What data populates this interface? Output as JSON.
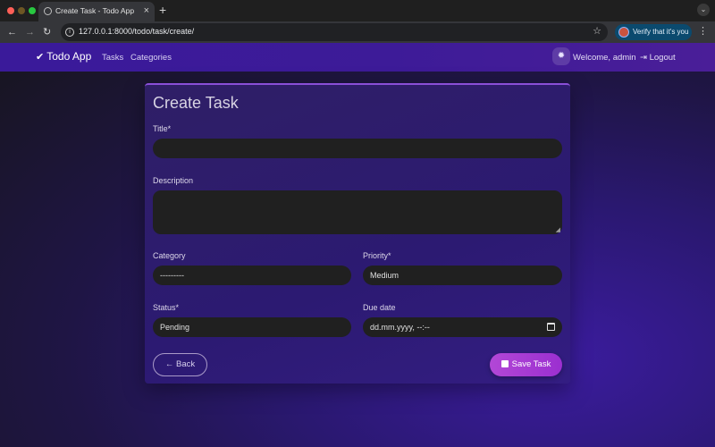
{
  "browser": {
    "tab_title": "Create Task - Todo App",
    "new_tab": "+",
    "tab_close": "×",
    "tab_menu": "⌄",
    "url": "127.0.0.1:8000/todo/task/create/",
    "back": "←",
    "forward": "→",
    "reload": "↻",
    "bookmark": "☆",
    "verify_label": "Verify that it's you",
    "menu": "⋮"
  },
  "navbar": {
    "brand": "Todo App",
    "brand_icon": "✔",
    "links": [
      "Tasks",
      "Categories"
    ],
    "theme_icon": "✹",
    "welcome": "Welcome, admin",
    "logout_icon": "⇥",
    "logout": "Logout"
  },
  "form": {
    "title": "Create Task",
    "fields": {
      "title": {
        "label": "Title*",
        "value": ""
      },
      "description": {
        "label": "Description",
        "value": ""
      },
      "category": {
        "label": "Category",
        "value": "---------"
      },
      "priority": {
        "label": "Priority*",
        "value": "Medium"
      },
      "status": {
        "label": "Status*",
        "value": "Pending"
      },
      "due_date": {
        "label": "Due date",
        "value": "dd.mm.yyyy, --:--"
      }
    },
    "back_button": "Back",
    "back_icon": "←",
    "save_button": "Save Task"
  },
  "colors": {
    "navbar": "#3a1a9a",
    "accent": "#b247d6",
    "input_bg": "#202020"
  }
}
